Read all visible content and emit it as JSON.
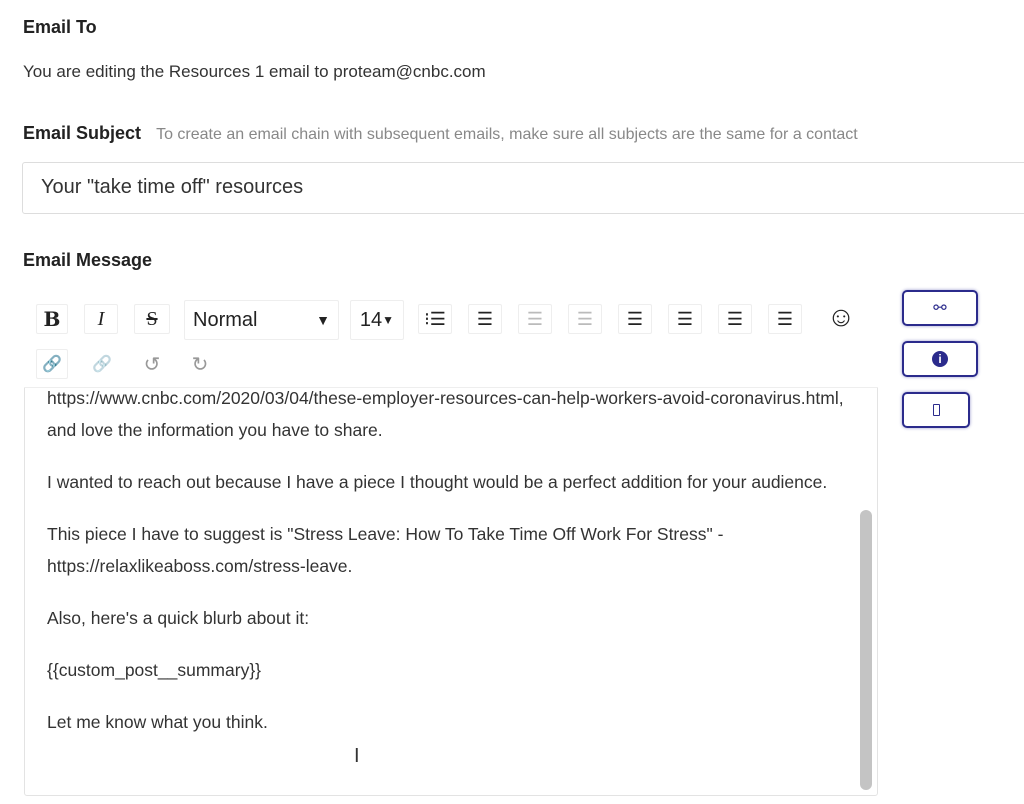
{
  "email_to": {
    "label": "Email To",
    "text": "You are editing the Resources 1 email to proteam@cnbc.com"
  },
  "email_subject": {
    "label": "Email Subject",
    "hint": "To create an email chain with subsequent emails, make sure all subjects are the same for a contact",
    "value": "Your \"take time off\" resources"
  },
  "email_message": {
    "label": "Email Message",
    "toolbar": {
      "bold": "B",
      "italic": "I",
      "strike": "S",
      "format": "Normal",
      "size": "14"
    },
    "paragraphs": [
      "https://www.cnbc.com/2020/03/04/these-employer-resources-can-help-workers-avoid-coronavirus.html, and love the information you have to share.",
      "I wanted to reach out because I have a piece I thought would be a perfect addition for your audience.",
      "This piece I have to suggest is \"Stress Leave: How To Take Time Off Work For Stress\" - https://relaxlikeaboss.com/stress-leave.",
      "Also, here's a quick blurb about it:",
      "{{custom_post__summary}}",
      "Let me know what you think."
    ]
  },
  "accent_color": "#2b2b8c"
}
